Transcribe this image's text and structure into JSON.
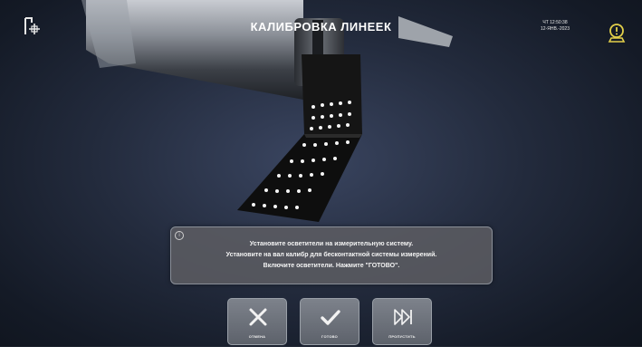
{
  "header": {
    "title": "КАЛИБРОВКА ЛИНЕЕК",
    "day_time": "ЧТ 12:50:38",
    "date": "12-ЯНВ.-2023"
  },
  "icons": {
    "top_left": "sensor-calibration-icon",
    "top_right": "alert-user-icon"
  },
  "message": {
    "lines": [
      "Установите осветители на измерительную систему.",
      "Установите на вал калибр для бесконтактной системы измерений.",
      "Включите осветители. Нажмите \"ГОТОВО\"."
    ]
  },
  "buttons": {
    "cancel": {
      "label": "ОТМЕНА",
      "icon": "close-icon"
    },
    "done": {
      "label": "ГОТОВО",
      "icon": "check-icon"
    },
    "skip": {
      "label": "ПРОПУСТИТЬ",
      "icon": "skip-icon"
    }
  }
}
